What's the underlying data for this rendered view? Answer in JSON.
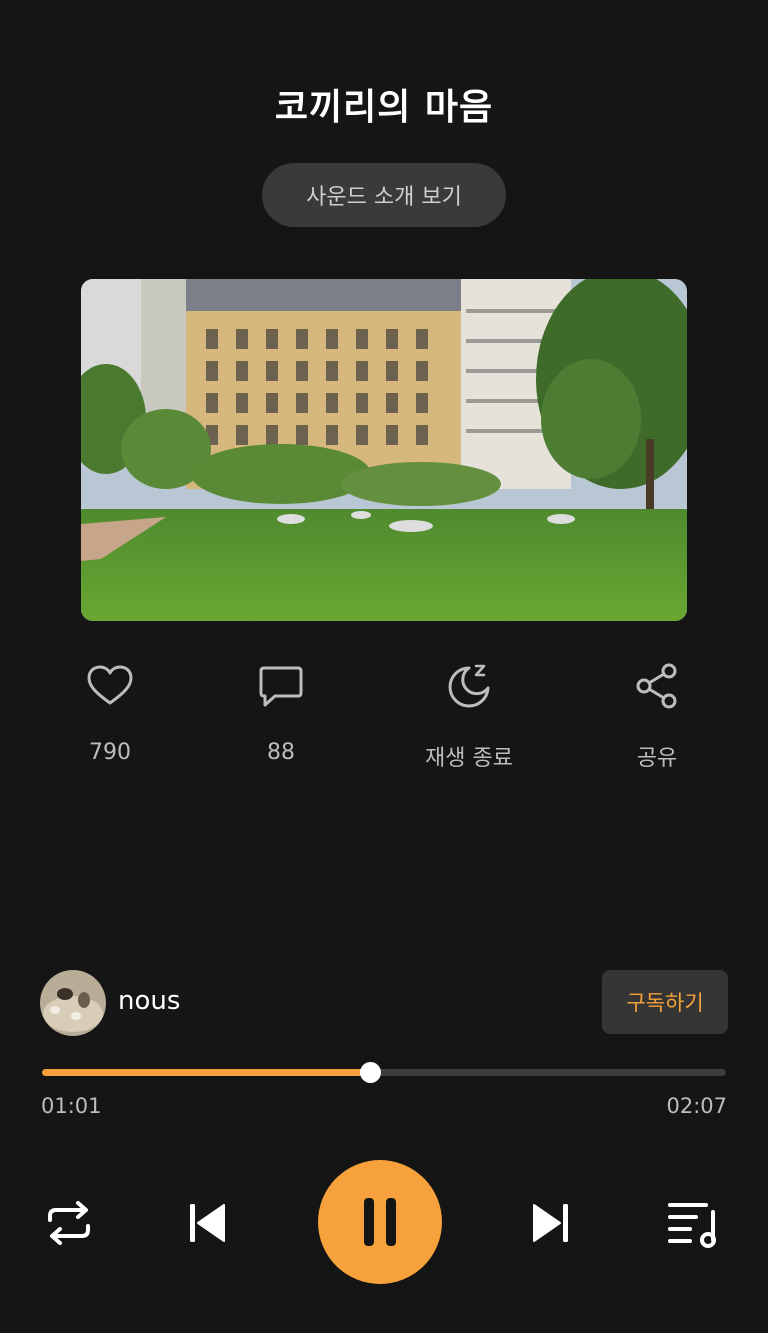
{
  "title": "코끼리의 마음",
  "intro_button": "사운드 소개 보기",
  "actions": [
    {
      "icon": "heart-icon",
      "label": "790"
    },
    {
      "icon": "comment-icon",
      "label": "88"
    },
    {
      "icon": "sleep-timer-icon",
      "label": "재생 종료"
    },
    {
      "icon": "share-icon",
      "label": "공유"
    }
  ],
  "channel": {
    "name": "nous",
    "subscribe_label": "구독하기"
  },
  "playback": {
    "elapsed": "01:01",
    "duration": "02:07",
    "progress": 0.48,
    "state": "playing"
  },
  "colors": {
    "accent": "#f5a13c",
    "background": "#151515"
  }
}
